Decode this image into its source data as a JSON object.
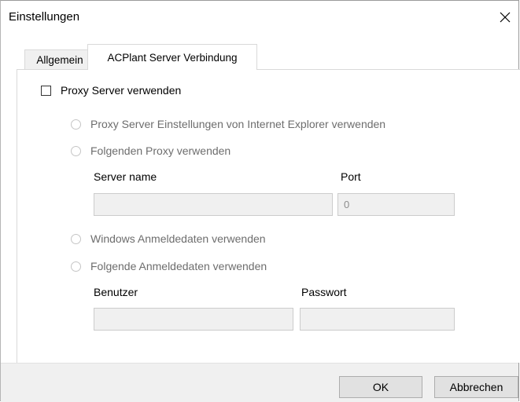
{
  "window": {
    "title": "Einstellungen",
    "close_label": "✕"
  },
  "tabs": [
    {
      "label": "Allgemein",
      "active": false
    },
    {
      "label": "ACPlant Server Verbindung",
      "active": true
    }
  ],
  "proxy": {
    "use_proxy_label": "Proxy Server verwenden",
    "use_proxy_checked": false,
    "option_ie_label": "Proxy Server Einstellungen von Internet Explorer verwenden",
    "option_custom_label": "Folgenden Proxy verwenden",
    "server_name_label": "Server name",
    "server_name_value": "",
    "port_label": "Port",
    "port_value": "0"
  },
  "auth": {
    "option_windows_label": "Windows Anmeldedaten verwenden",
    "option_custom_label": "Folgende Anmeldedaten verwenden",
    "user_label": "Benutzer",
    "user_value": "",
    "password_label": "Passwort",
    "password_value": ""
  },
  "buttons": {
    "ok_label": "OK",
    "cancel_label": "Abbrechen"
  },
  "colors": {
    "disabled_text": "#6d6d6d",
    "disabled_field_bg": "#f0f0f0",
    "footer_bg": "#f0f0f0"
  }
}
